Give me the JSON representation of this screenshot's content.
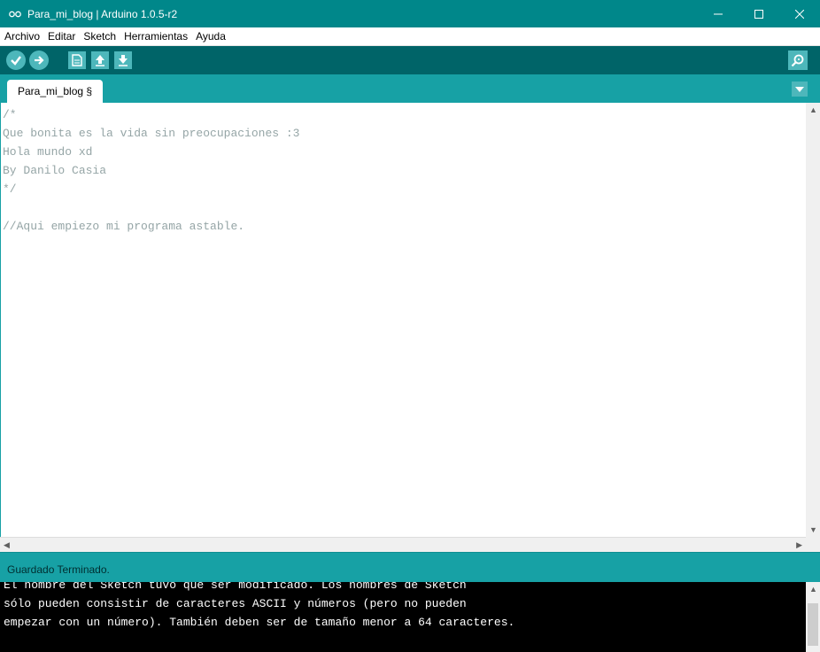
{
  "window": {
    "title": "Para_mi_blog | Arduino 1.0.5-r2"
  },
  "menu": {
    "items": [
      "Archivo",
      "Editar",
      "Sketch",
      "Herramientas",
      "Ayuda"
    ]
  },
  "toolbar": {
    "buttons": [
      {
        "name": "verify",
        "icon": "check-icon"
      },
      {
        "name": "upload",
        "icon": "arrow-right-icon"
      },
      {
        "name": "new",
        "icon": "document-icon"
      },
      {
        "name": "open",
        "icon": "arrow-up-icon"
      },
      {
        "name": "save",
        "icon": "arrow-down-icon"
      }
    ],
    "serial_monitor_icon": "magnifier-icon"
  },
  "tabs": [
    {
      "label": "Para_mi_blog §"
    }
  ],
  "editor": {
    "lines": [
      "/*",
      "Que bonita es la vida sin preocupaciones :3",
      "Hola mundo xd",
      "By Danilo Casia",
      "*/",
      "",
      "//Aqui empiezo mi programa astable."
    ]
  },
  "status": {
    "text": "Guardado Terminado."
  },
  "console": {
    "lines": [
      "El nombre del Sketch tuvo que ser modificado. Los nombres de Sketch",
      "sólo pueden consistir de caracteres ASCII y números (pero no pueden",
      "empezar con un número). También deben ser de tamaño menor a 64 caracteres."
    ]
  },
  "colors": {
    "titlebar": "#00878a",
    "toolbar": "#006468",
    "tabsbar": "#17a1a5",
    "button": "#4db7bb",
    "console_bg": "#000000"
  }
}
